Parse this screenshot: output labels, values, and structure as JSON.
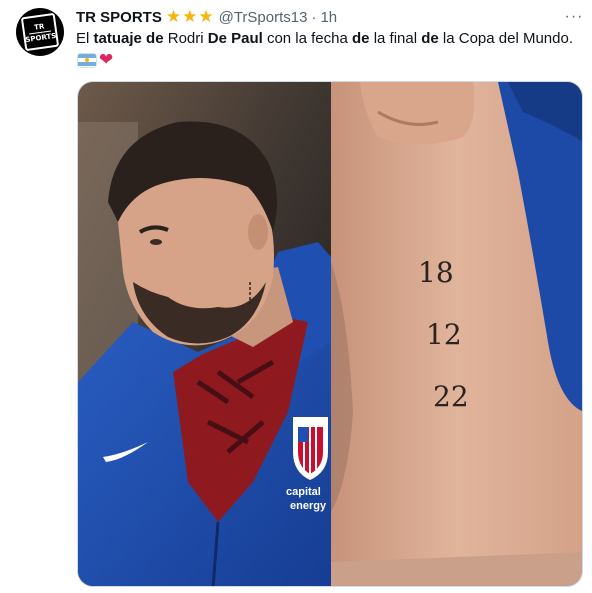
{
  "tweet": {
    "author_name": "TR SPORTS",
    "verified_stars": 3,
    "handle": "@TrSports13",
    "separator": "·",
    "time": "1h",
    "more_label": "···",
    "text_segments": [
      {
        "text": "El ",
        "bold": false
      },
      {
        "text": "tatuaje",
        "bold": true
      },
      {
        "text": " ",
        "bold": false
      },
      {
        "text": "de",
        "bold": true
      },
      {
        "text": " Rodri ",
        "bold": false
      },
      {
        "text": "De Paul",
        "bold": true
      },
      {
        "text": " con la fecha ",
        "bold": false
      },
      {
        "text": "de",
        "bold": true
      },
      {
        "text": " la final ",
        "bold": false
      },
      {
        "text": "de",
        "bold": true
      },
      {
        "text": " la Copa del Mundo.",
        "bold": false
      }
    ],
    "emojis": [
      "argentina-flag",
      "red-heart"
    ],
    "avatar_logo": {
      "line1": "TR",
      "line2": "SPORTS"
    }
  },
  "media": {
    "tattoo_digits": [
      "18",
      "12",
      "22"
    ],
    "jacket_sponsor_line1": "capital",
    "jacket_sponsor_line2": "energy",
    "colors": {
      "jacket": "#1f4fb0",
      "skin": "#d9a88d",
      "hair": "#2a211d",
      "shirt": "#a11b22"
    }
  }
}
